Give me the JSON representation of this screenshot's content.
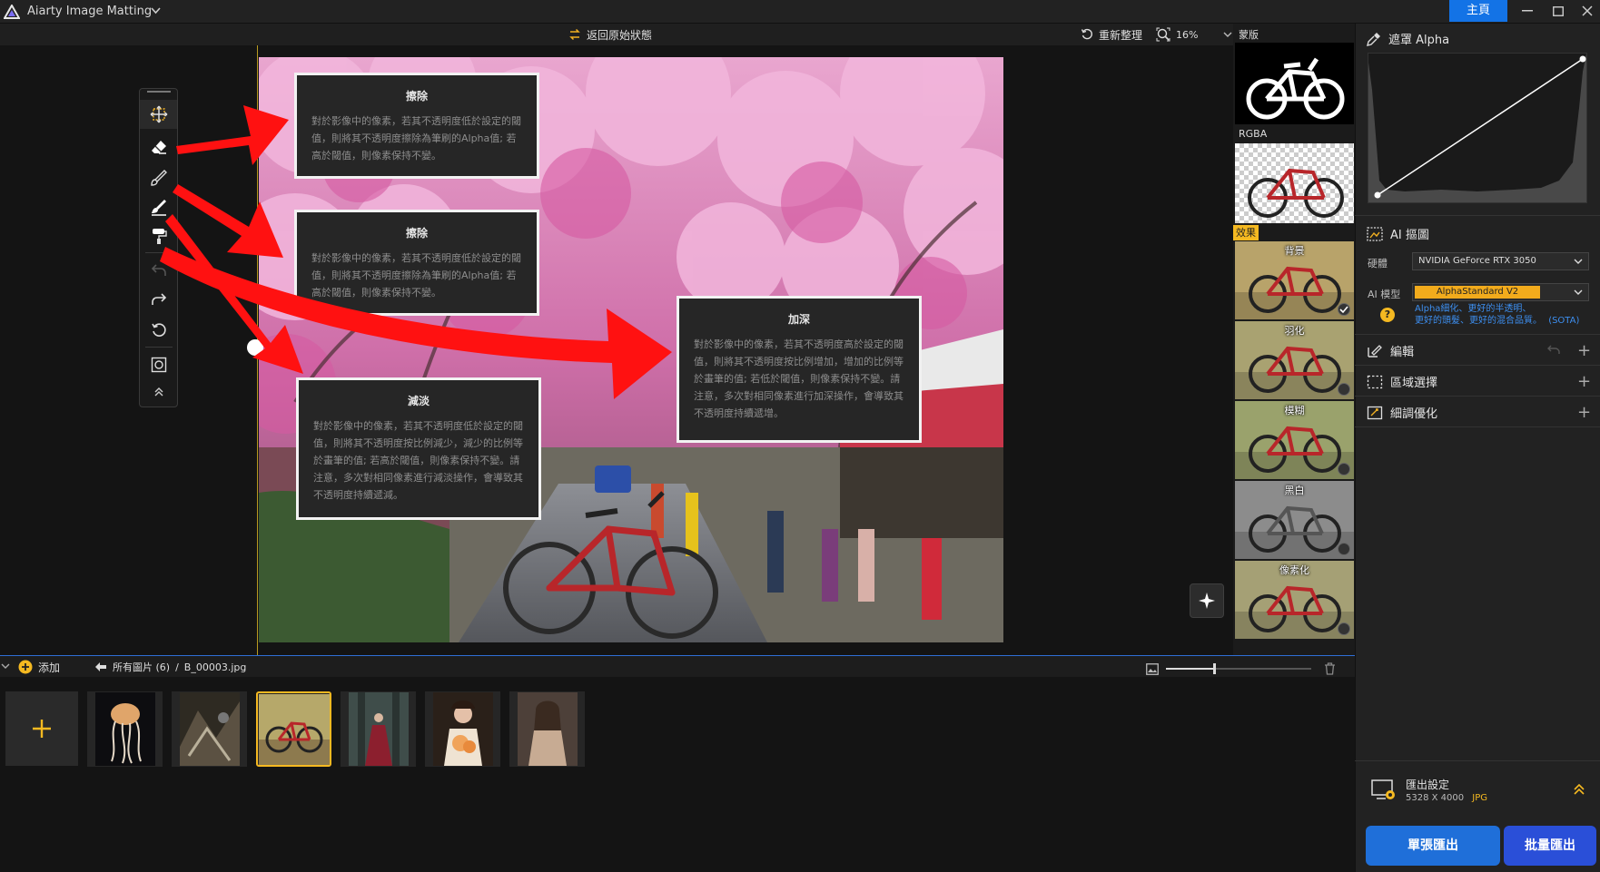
{
  "app": {
    "title": "Aiarty Image Matting",
    "home_label": "主頁"
  },
  "canvas_toolbar": {
    "restore_label": "返回原始狀態",
    "reorganize_label": "重新整理",
    "zoom_value": "16%"
  },
  "callouts": {
    "erase_1": {
      "title": "擦除",
      "body": "對於影像中的像素，若其不透明度低於設定的閾值，則將其不透明度擦除為筆刷的Alpha值; 若高於閾值，則像素保持不變。"
    },
    "erase_2": {
      "title": "擦除",
      "body": "對於影像中的像素，若其不透明度低於設定的閾值，則將其不透明度擦除為筆刷的Alpha值; 若高於閾值，則像素保持不變。"
    },
    "lighten": {
      "title": "減淡",
      "body": "對於影像中的像素，若其不透明度低於設定的閾值，則將其不透明度按比例減少，減少的比例等於畫筆的值; 若高於閾值，則像素保持不變。請注意，多次對相同像素進行減淡操作，會導致其不透明度持續遞減。"
    },
    "deepen": {
      "title": "加深",
      "body": "對於影像中的像素，若其不透明度高於設定的閾值，則將其不透明度按比例增加，增加的比例等於畫筆的值; 若低於閾值，則像素保持不變。請注意，多次對相同像素進行加深操作，會導致其不透明度持續遞增。"
    }
  },
  "preview": {
    "mask_label": "蒙版",
    "rgba_label": "RGBA",
    "effects_label": "效果",
    "effects": [
      {
        "name": "背景",
        "selected": true
      },
      {
        "name": "羽化",
        "selected": false
      },
      {
        "name": "模糊",
        "selected": false
      },
      {
        "name": "黑白",
        "selected": false
      },
      {
        "name": "像素化",
        "selected": false
      }
    ]
  },
  "right_panel": {
    "alpha_title": "遮罩 Alpha",
    "ai_matting_title": "AI 摳圖",
    "hardware_label": "硬體",
    "hardware_value": "NVIDIA GeForce RTX 3050",
    "model_label": "AI 模型",
    "model_value": "AlphaStandard  V2",
    "model_desc_1": "Alpha細化、更好的半透明、",
    "model_desc_2": "更好的頭髮、更好的混合品質。",
    "model_tag": "(SOTA)",
    "edit_title": "編輯",
    "region_title": "區域選擇",
    "refine_title": "細調優化",
    "export_settings_label": "匯出設定",
    "export_size": "5328 X 4000",
    "export_format": "JPG",
    "single_export_label": "單張匯出",
    "batch_export_label": "批量匯出"
  },
  "bottom": {
    "add_label": "添加",
    "all_images_label": "所有圖片 (6)",
    "separator": "/",
    "current_file": "B_00003.jpg"
  },
  "colors": {
    "accent_blue": "#1373e6",
    "accent_yellow": "#f5b921",
    "arrow_red": "#ff1111"
  }
}
